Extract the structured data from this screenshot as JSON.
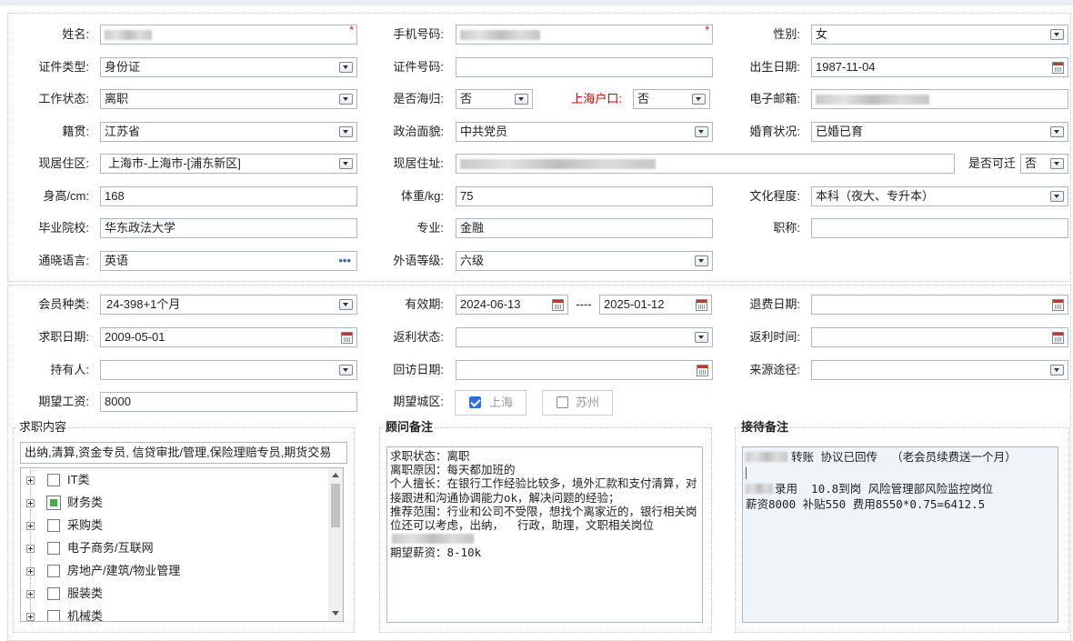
{
  "labels": {
    "name": "姓名:",
    "phone": "手机号码:",
    "gender": "性别:",
    "id_type": "证件类型:",
    "id_number": "证件号码:",
    "birth_date": "出生日期:",
    "work_status": "工作状态:",
    "returnee": "是否海归:",
    "shanghai_hukou": "上海户口:",
    "email": "电子邮箱:",
    "native_place": "籍贯:",
    "political_status": "政治面貌:",
    "marital_status": "婚育状况:",
    "current_area": "现居住区:",
    "current_address": "现居住址:",
    "relocate": "是否可迁",
    "height": "身高/cm:",
    "weight": "体重/kg:",
    "education": "文化程度:",
    "school": "毕业院校:",
    "major": "专业:",
    "title": "职称:",
    "language": "通晓语言:",
    "foreign_level": "外语等级:",
    "member_type": "会员种类:",
    "valid_period": "有效期:",
    "period_sep": "----",
    "refund_date": "退费日期:",
    "job_search_date": "求职日期:",
    "rebate_status": "返利状态:",
    "rebate_time": "返利时间:",
    "holder": "持有人:",
    "visit_date": "回访日期:",
    "source": "来源途径:",
    "expected_salary": "期望工资:",
    "expected_city": "期望城区:"
  },
  "values": {
    "gender": "女",
    "id_type": "身份证",
    "id_number": "",
    "birth_date": "1987-11-04",
    "work_status": "离职",
    "returnee": "否",
    "shanghai_hukou": "否",
    "native_place": "江苏省",
    "political_status": "中共党员",
    "marital_status": "已婚已育",
    "current_area": "上海市-上海市-[浦东新区]",
    "relocate": "否",
    "height": "168",
    "weight": "75",
    "education": "本科（夜大、专升本）",
    "school": "华东政法大学",
    "major": "金融",
    "title": "",
    "language": "英语",
    "foreign_level": "六级",
    "member_type": "24-398+1个月",
    "valid_from": "2024-06-13",
    "valid_to": "2025-01-12",
    "refund_date": "",
    "job_search_date": "2009-05-01",
    "rebate_status": "",
    "rebate_time": "",
    "holder": "",
    "visit_date": "",
    "source": "",
    "expected_salary": "8000"
  },
  "required_mark": "*",
  "language_more": "•••",
  "cities": [
    {
      "label": "上海",
      "checked": true
    },
    {
      "label": "苏州",
      "checked": false
    }
  ],
  "job_content": {
    "legend": "求职内容",
    "summary": "出纳,清算,资金专员, 信贷审批/管理,保险理赔专员,期货交易",
    "tree": [
      {
        "label": "IT类",
        "checked": false
      },
      {
        "label": "财务类",
        "checked": true
      },
      {
        "label": "采购类",
        "checked": false
      },
      {
        "label": "电子商务/互联网",
        "checked": false
      },
      {
        "label": "房地产/建筑/物业管理",
        "checked": false
      },
      {
        "label": "服装类",
        "checked": false
      },
      {
        "label": "机械类",
        "checked": false
      }
    ]
  },
  "advisor_notes": {
    "legend": "顾问备注",
    "lines": [
      "求职状态：离职",
      "离职原因：每天都加班的",
      "个人擅长：在银行工作经验比较多，境外汇款和支付清算，对接跟进和沟通协调能力ok，解决问题的经验；",
      "推荐范围：行业和公司不受限，想找个离家近的，银行相关岗位还可以考虑，出纳，  行政，助理，文职相关岗位",
      "",
      "期望薪资：8-10k"
    ]
  },
  "reception_notes": {
    "legend": "接待备注",
    "line1": "转账 协议已回传  （老会员续费送一个月）",
    "line2": "录用  10.8到岗 风险管理部风险监控岗位",
    "line3": "薪资8000 补贴550 费用8550*0.75=6412.5"
  },
  "colors": {
    "field_border": "#a9b8c8",
    "required": "#e00000",
    "hukou_label": "#d00000",
    "checked_green": "#3fb04a",
    "checked_blue": "#2e6fd8"
  }
}
